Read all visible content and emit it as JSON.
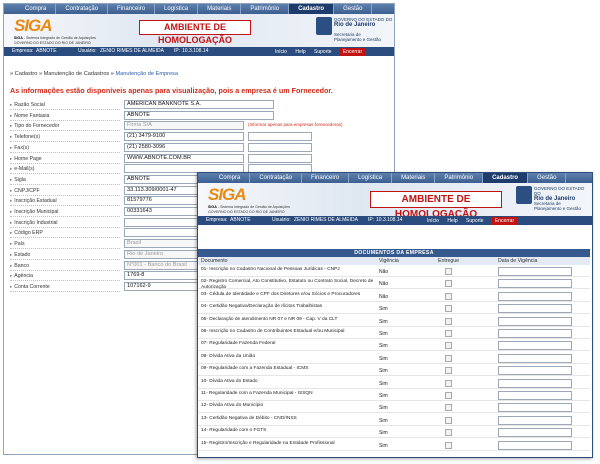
{
  "nav": {
    "items": [
      "Compra",
      "Contratação",
      "Financeiro",
      "Logística",
      "Materiais",
      "Patrimônio",
      "Cadastro",
      "Gestão"
    ],
    "active": "Cadastro"
  },
  "banner": {
    "logo": "SIGA",
    "subtitle_bold": "SIGA",
    "subtitle": " - Sistema Integrado de Gestão de Aquisições",
    "subtitle2": "GOVERNO DO ESTADO DO RIO DE JANEIRO",
    "homolog": "AMBIENTE DE HOMOLOGAÇÃO",
    "gov_line1": "GOVERNO DO ESTADO DO",
    "gov_line2": "Rio de Janeiro",
    "gov_sec1": "Secretaria de",
    "gov_sec2": "Planejamento e Gestão"
  },
  "infobar": {
    "empresa_label": "Empresa:",
    "empresa": "ABNOTE",
    "usuario_label": "Usuário:",
    "usuario": "ZENIO RIMES DE ALMEIDA",
    "ip_label": "IP:",
    "ip": "10.3.108.14"
  },
  "toolbar": {
    "inicio": "Início",
    "help": "Help",
    "suporte": "Suporte",
    "encerrar": "Encerrar"
  },
  "breadcrumb": {
    "a": "Cadastro",
    "b": "Manutenção de Cadastros",
    "c": "Manutenção de Empresa"
  },
  "notice": "As informações estão disponíveis apenas para visualização, pois a empresa é um Fornecedor.",
  "form": [
    {
      "label": "Razão Social",
      "value": "AMERICAN BANKNOTE S.A.",
      "w": 150
    },
    {
      "label": "Nome Fantasia",
      "value": "ABNOTE",
      "w": 150
    },
    {
      "label": "Tipo do Fornecedor",
      "value": "Firma S/A",
      "w": 120,
      "dis": true,
      "hint": "(Informar apenas para empresas fornecedoras)"
    },
    {
      "label": "Telefone(s)",
      "value": "(21) 3479-9100",
      "w": 120,
      "extra": true
    },
    {
      "label": "Fax(s)",
      "value": "(21) 2580-3096",
      "w": 120,
      "extra": true
    },
    {
      "label": "Home Page",
      "value": "WWW.ABNOTE.COM.BR",
      "w": 120,
      "extra": true
    },
    {
      "label": "e-Mail(s)",
      "value": "",
      "w": 120,
      "extra": true
    },
    {
      "label": "Sigla",
      "value": "ABNOTE",
      "w": 120
    },
    {
      "label": "CNPJ/CPF",
      "value": "33.113.309/0001-47",
      "w": 120
    },
    {
      "label": "Inscrição Estadual",
      "value": "81579776",
      "w": 80
    },
    {
      "label": "Inscrição Municipal",
      "value": "00331643",
      "w": 80
    },
    {
      "label": "Inscrição Industrial",
      "value": "",
      "w": 80
    },
    {
      "label": "Código ERP",
      "value": "",
      "w": 80
    },
    {
      "label": "País",
      "value": "Brasil",
      "w": 80,
      "dis": true
    },
    {
      "label": "Estado",
      "value": "Rio de Janeiro",
      "w": 80,
      "dis": true
    },
    {
      "label": "Banco",
      "value": "N°001 - Banco do Brasil",
      "w": 80,
      "dis": true
    },
    {
      "label": "Agência",
      "value": "1769-8",
      "w": 80
    },
    {
      "label": "Conta Corrente",
      "value": "107162-9",
      "w": 80
    }
  ],
  "docs": {
    "title": "DOCUMENTOS DA EMPRESA",
    "headers": [
      "Documento",
      "Vigência",
      "Entregue",
      "Data de Vigência"
    ],
    "rows": [
      {
        "name": "01- Inscrição no Cadastro Nacional de Pessoas Jurídicas - CNPJ",
        "vig": "Não"
      },
      {
        "name": "02- Registro Comercial, Ato Constitutivo, Estatuto ou Contrato Social, Decreto de Autorização",
        "vig": "Não"
      },
      {
        "name": "03- Cédula de Identidade e CPF dos Diretores e/ou Sócios e Procuradores",
        "vig": "Não"
      },
      {
        "name": "04- Certidão Negativa/Declaração de Ilícitos Trabalhistas",
        "vig": "Sim"
      },
      {
        "name": "05- Declaração de atendimento NR 07 e NR 09 - Cap. V da CLT",
        "vig": "Sim"
      },
      {
        "name": "06- Inscrição no Cadastro de Contribuintes Estadual e/ou Municipal",
        "vig": "Sim"
      },
      {
        "name": "07- Regularidade Fazenda Federal",
        "vig": "Sim"
      },
      {
        "name": "08- Dívida Ativa da União",
        "vig": "Sim"
      },
      {
        "name": "09- Regularidade com a Fazenda Estadual - ICMS",
        "vig": "Sim"
      },
      {
        "name": "10- Dívida Ativa do Estado",
        "vig": "Sim"
      },
      {
        "name": "11- Regularidade com a Fazenda Municipal - ISSQN",
        "vig": "Sim"
      },
      {
        "name": "12- Dívida Ativa do Município",
        "vig": "Sim"
      },
      {
        "name": "13- Certidão Negativa de Débito - CND/INSS",
        "vig": "Sim"
      },
      {
        "name": "14- Regularidade com o FGTS",
        "vig": "Sim"
      },
      {
        "name": "15- Registro/Inscrição e Regularidade na Entidade Profissional",
        "vig": "Sim"
      }
    ]
  },
  "colors": {
    "nav": "#3c5f8f",
    "infobar": "#2a4c7e",
    "alert": "#d12a1a",
    "logo_orange": "#e98a14"
  }
}
